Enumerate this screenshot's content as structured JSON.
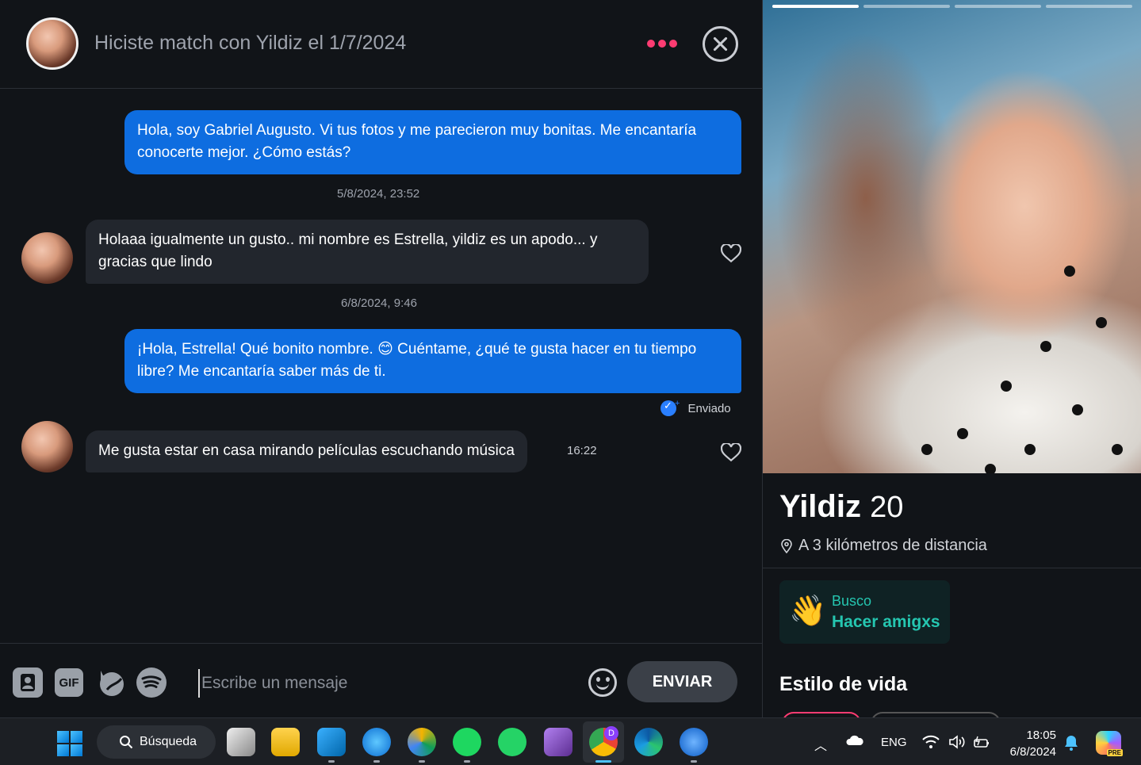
{
  "chat": {
    "header_title": "Hiciste match con Yildiz el 1/7/2024",
    "messages": [
      {
        "text": "Hola, soy Gabriel Augusto. Vi tus fotos y me parecieron muy bonitas. Me encantaría conocerte mejor. ¿Cómo estás?"
      },
      {
        "text": "Holaaa igualmente un gusto.. mi nombre es Estrella, yildiz es un apodo... y gracias que lindo"
      },
      {
        "text": "¡Hola, Estrella! Qué bonito nombre. 😊 Cuéntame, ¿qué te gusta hacer en tu tiempo libre? Me encantaría saber más de ti."
      },
      {
        "text": "Me gusta estar en casa mirando películas escuchando música",
        "time": "16:22"
      }
    ],
    "timestamps": [
      "5/8/2024, 23:52",
      "6/8/2024, 9:46"
    ],
    "status_label": "Enviado",
    "composer": {
      "gif_label": "GIF",
      "placeholder": "Escribe un mensaje",
      "send_label": "ENVIAR"
    }
  },
  "profile": {
    "name": "Yildiz",
    "age": "20",
    "distance": "A 3 kilómetros de distancia",
    "looking_for_label": "Busco",
    "looking_for_value": "Hacer amigxs",
    "lifestyle_title": "Estilo de vida",
    "accent_color": "#25c6b0"
  },
  "taskbar": {
    "search_label": "Búsqueda",
    "language": "ENG",
    "time": "18:05",
    "date": "6/8/2024",
    "chrome_badge": "D",
    "copilot_badge": "PRE"
  }
}
